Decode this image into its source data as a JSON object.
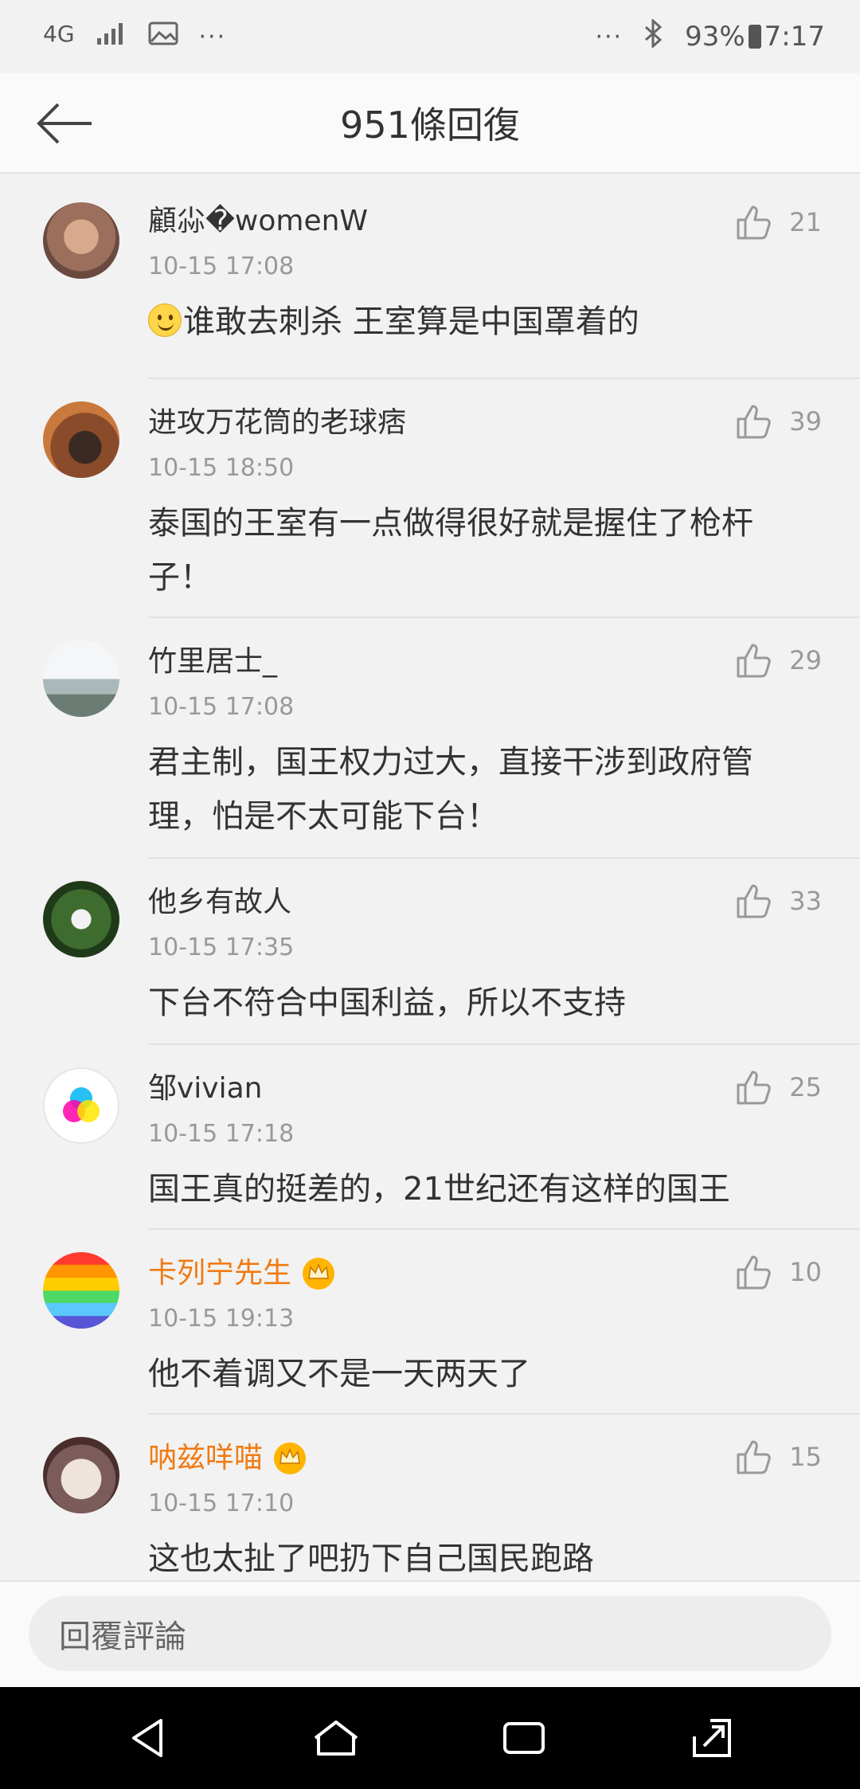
{
  "status_bar": {
    "network": "4G",
    "dots_left": "···",
    "dots_right": "···",
    "battery": "93%",
    "time": "7:17"
  },
  "header": {
    "title": "951條回復",
    "back_icon": "arrow-left-icon"
  },
  "comments": [
    {
      "name": "顧尛�womenW",
      "time": "10-15 17:08",
      "text": "谁敢去刺杀 王室算是中国罩着的",
      "likes": "21",
      "vip": false,
      "emoji": true
    },
    {
      "name": "进攻万花筒的老球痞",
      "time": "10-15 18:50",
      "text": "泰国的王室有一点做得很好就是握住了枪杆子！",
      "likes": "39",
      "vip": false,
      "emoji": false
    },
    {
      "name": "竹里居士_",
      "time": "10-15 17:08",
      "text": "君主制，国王权力过大，直接干涉到政府管理，怕是不太可能下台！",
      "likes": "29",
      "vip": false,
      "emoji": false
    },
    {
      "name": "他乡有故人",
      "time": "10-15 17:35",
      "text": "下台不符合中国利益，所以不支持",
      "likes": "33",
      "vip": false,
      "emoji": false
    },
    {
      "name": "邹vivian",
      "time": "10-15 17:18",
      "text": "国王真的挺差的，21世纪还有这样的国王",
      "likes": "25",
      "vip": false,
      "emoji": false
    },
    {
      "name": "卡列宁先生",
      "time": "10-15 19:13",
      "text": "他不着调又不是一天两天了",
      "likes": "10",
      "vip": true,
      "emoji": false
    },
    {
      "name": "呐兹咩喵",
      "time": "10-15 17:10",
      "text": "这也太扯了吧扔下自己国民跑路",
      "likes": "15",
      "vip": true,
      "emoji": false
    }
  ],
  "reply": {
    "placeholder": "回覆評論"
  },
  "colors": {
    "vip_name": "#f07b14",
    "muted": "#999999",
    "background": "#f2f2f2"
  }
}
